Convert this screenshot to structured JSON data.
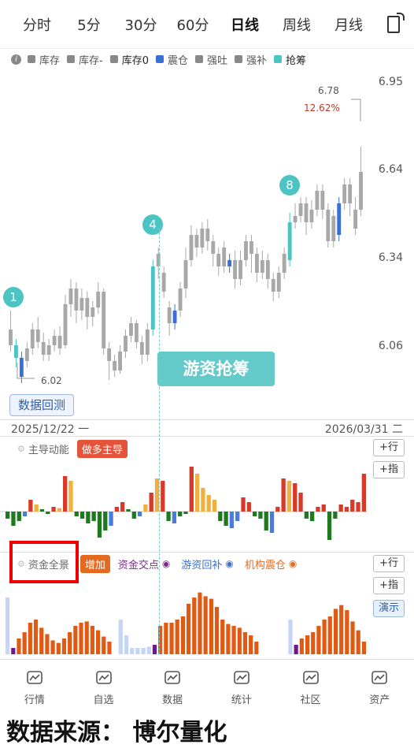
{
  "tabs": [
    "分时",
    "5分",
    "30分",
    "60分",
    "日线",
    "周线",
    "月线"
  ],
  "active_tab": "日线",
  "legend": [
    {
      "label": "库存",
      "color": "#888888"
    },
    {
      "label": "库存-",
      "color": "#888888"
    },
    {
      "label": "库存0",
      "color": "#888888"
    },
    {
      "label": "震仓",
      "color": "#3a6fd8"
    },
    {
      "label": "强吐",
      "color": "#888888"
    },
    {
      "label": "强补",
      "color": "#888888"
    },
    {
      "label": "抢筹",
      "color": "#4cc4c4"
    }
  ],
  "y_axis": [
    "6.95",
    "6.64",
    "6.34",
    "6.06"
  ],
  "high_annotation": {
    "price": "6.78",
    "pct": "12.62%"
  },
  "low_annotation": "6.02",
  "markers": [
    "1",
    "4",
    "8"
  ],
  "banner": "游资抢筹",
  "backtest_label": "数据回测",
  "date_start": "2025/12/22 一",
  "date_end": "2026/03/31 二",
  "panel1": {
    "title": "主导动能",
    "tag": "做多主导",
    "btn_row": "+行",
    "btn_idx": "+指"
  },
  "panel2": {
    "title": "资金全景",
    "tag": "增加",
    "legends": [
      {
        "label": "资金交点",
        "color": "#7b2a8c"
      },
      {
        "label": "游资回补",
        "color": "#3a6fd8"
      },
      {
        "label": "机构震仓",
        "color": "#e36a1e"
      }
    ],
    "btn_row": "+行",
    "btn_idx": "+指",
    "btn_demo": "演示"
  },
  "nav": [
    "行情",
    "自选",
    "数据",
    "统计",
    "社区",
    "资产"
  ],
  "source_text": "数据来源： 博尔量化",
  "chart_data": {
    "type": "candlestick",
    "ylim": [
      5.95,
      7.0
    ],
    "candles": [
      [
        6.2,
        6.15,
        6.26,
        6.13,
        "g"
      ],
      [
        6.15,
        6.11,
        6.17,
        6.08,
        "c"
      ],
      [
        6.11,
        6.05,
        6.13,
        6.03,
        "b"
      ],
      [
        6.1,
        6.14,
        6.16,
        6.08,
        "g"
      ],
      [
        6.14,
        6.2,
        6.22,
        6.12,
        "g"
      ],
      [
        6.2,
        6.16,
        6.24,
        6.14,
        "g"
      ],
      [
        6.16,
        6.12,
        6.19,
        6.1,
        "g"
      ],
      [
        6.12,
        6.15,
        6.17,
        6.1,
        "g"
      ],
      [
        6.15,
        6.18,
        6.2,
        6.13,
        "g"
      ],
      [
        6.18,
        6.14,
        6.21,
        6.12,
        "g"
      ],
      [
        6.15,
        6.28,
        6.31,
        6.14,
        "g"
      ],
      [
        6.28,
        6.33,
        6.36,
        6.24,
        "g"
      ],
      [
        6.33,
        6.26,
        6.35,
        6.22,
        "g"
      ],
      [
        6.26,
        6.3,
        6.33,
        6.23,
        "g"
      ],
      [
        6.3,
        6.24,
        6.32,
        6.2,
        "g"
      ],
      [
        6.24,
        6.27,
        6.29,
        6.21,
        "g"
      ],
      [
        6.27,
        6.32,
        6.35,
        6.25,
        "g"
      ],
      [
        6.32,
        6.14,
        6.33,
        6.12,
        "g"
      ],
      [
        6.14,
        6.1,
        6.16,
        6.04,
        "g"
      ],
      [
        6.1,
        6.07,
        6.12,
        6.05,
        "g"
      ],
      [
        6.07,
        6.13,
        6.15,
        6.06,
        "g"
      ],
      [
        6.13,
        6.18,
        6.2,
        6.11,
        "g"
      ],
      [
        6.18,
        6.22,
        6.24,
        6.16,
        "g"
      ],
      [
        6.22,
        6.16,
        6.23,
        6.14,
        "g"
      ],
      [
        6.16,
        6.12,
        6.18,
        6.09,
        "g"
      ],
      [
        6.12,
        6.2,
        6.22,
        6.1,
        "g"
      ],
      [
        6.2,
        6.4,
        6.42,
        6.18,
        "c"
      ],
      [
        6.4,
        6.44,
        6.46,
        6.36,
        "g"
      ],
      [
        6.32,
        6.38,
        6.4,
        6.3,
        "g"
      ],
      [
        6.22,
        6.27,
        6.29,
        6.18,
        "g"
      ],
      [
        6.22,
        6.26,
        6.28,
        6.2,
        "b"
      ],
      [
        6.26,
        6.33,
        6.35,
        6.24,
        "g"
      ],
      [
        6.33,
        6.42,
        6.46,
        6.3,
        "g"
      ],
      [
        6.42,
        6.5,
        6.53,
        6.4,
        "g"
      ],
      [
        6.5,
        6.46,
        6.52,
        6.43,
        "g"
      ],
      [
        6.46,
        6.52,
        6.54,
        6.44,
        "g"
      ],
      [
        6.52,
        6.48,
        6.55,
        6.45,
        "g"
      ],
      [
        6.48,
        6.44,
        6.5,
        6.4,
        "g"
      ],
      [
        6.44,
        6.4,
        6.46,
        6.37,
        "g"
      ],
      [
        6.4,
        6.46,
        6.48,
        6.38,
        "g"
      ],
      [
        6.4,
        6.42,
        6.44,
        6.38,
        "b"
      ],
      [
        6.42,
        6.36,
        6.45,
        6.33,
        "g"
      ],
      [
        6.36,
        6.42,
        6.45,
        6.34,
        "g"
      ],
      [
        6.42,
        6.48,
        6.5,
        6.4,
        "g"
      ],
      [
        6.48,
        6.44,
        6.5,
        6.38,
        "g"
      ],
      [
        6.44,
        6.38,
        6.46,
        6.35,
        "g"
      ],
      [
        6.38,
        6.42,
        6.45,
        6.36,
        "g"
      ],
      [
        6.42,
        6.36,
        6.44,
        6.33,
        "g"
      ],
      [
        6.36,
        6.32,
        6.38,
        6.29,
        "g"
      ],
      [
        6.32,
        6.38,
        6.4,
        6.3,
        "g"
      ],
      [
        6.38,
        6.44,
        6.46,
        6.36,
        "g"
      ],
      [
        6.42,
        6.54,
        6.57,
        6.4,
        "c"
      ],
      [
        6.54,
        6.56,
        6.6,
        6.52,
        "g"
      ],
      [
        6.56,
        6.6,
        6.62,
        6.54,
        "g"
      ],
      [
        6.6,
        6.54,
        6.62,
        6.5,
        "g"
      ],
      [
        6.54,
        6.58,
        6.61,
        6.52,
        "g"
      ],
      [
        6.58,
        6.64,
        6.66,
        6.56,
        "g"
      ],
      [
        6.64,
        6.58,
        6.66,
        6.55,
        "g"
      ],
      [
        6.58,
        6.48,
        6.6,
        6.46,
        "g"
      ],
      [
        6.48,
        6.56,
        6.58,
        6.46,
        "g"
      ],
      [
        6.5,
        6.6,
        6.62,
        6.48,
        "b"
      ],
      [
        6.6,
        6.66,
        6.68,
        6.58,
        "g"
      ],
      [
        6.66,
        6.6,
        6.68,
        6.56,
        "g"
      ],
      [
        6.52,
        6.58,
        6.62,
        6.5,
        "g"
      ],
      [
        6.58,
        6.7,
        6.78,
        6.56,
        "g"
      ]
    ]
  },
  "momentum_bars": [
    [
      -0.3,
      "g"
    ],
    [
      -0.6,
      "g"
    ],
    [
      -0.4,
      "g"
    ],
    [
      -0.2,
      "b"
    ],
    [
      0.5,
      "r"
    ],
    [
      0.3,
      "o"
    ],
    [
      0.1,
      "g"
    ],
    [
      -0.1,
      "g"
    ],
    [
      0.2,
      "r"
    ],
    [
      0.15,
      "o"
    ],
    [
      1.5,
      "r"
    ],
    [
      1.3,
      "o"
    ],
    [
      -0.2,
      "g"
    ],
    [
      -0.3,
      "g"
    ],
    [
      -0.5,
      "g"
    ],
    [
      -0.4,
      "g"
    ],
    [
      -1.1,
      "g"
    ],
    [
      -0.8,
      "g"
    ],
    [
      -0.6,
      "b"
    ],
    [
      0.2,
      "r"
    ],
    [
      0.4,
      "r"
    ],
    [
      0.1,
      "g"
    ],
    [
      -0.3,
      "g"
    ],
    [
      -0.2,
      "b"
    ],
    [
      0.3,
      "o"
    ],
    [
      0.8,
      "r"
    ],
    [
      1.4,
      "o"
    ],
    [
      1.3,
      "r"
    ],
    [
      -0.4,
      "g"
    ],
    [
      -0.5,
      "b"
    ],
    [
      -0.2,
      "g"
    ],
    [
      -0.1,
      "g"
    ],
    [
      1.9,
      "r"
    ],
    [
      1.6,
      "o"
    ],
    [
      1.0,
      "o"
    ],
    [
      0.7,
      "o"
    ],
    [
      0.5,
      "o"
    ],
    [
      -0.4,
      "g"
    ],
    [
      -0.6,
      "g"
    ],
    [
      -0.7,
      "b"
    ],
    [
      -0.4,
      "b"
    ],
    [
      0.6,
      "r"
    ],
    [
      0.4,
      "r"
    ],
    [
      -0.2,
      "g"
    ],
    [
      -0.3,
      "g"
    ],
    [
      -0.8,
      "g"
    ],
    [
      -0.9,
      "b"
    ],
    [
      0.2,
      "r"
    ],
    [
      1.4,
      "r"
    ],
    [
      1.3,
      "o"
    ],
    [
      1.2,
      "r"
    ],
    [
      0.8,
      "r"
    ],
    [
      -0.3,
      "g"
    ],
    [
      -0.4,
      "g"
    ],
    [
      0.2,
      "r"
    ],
    [
      0.3,
      "r"
    ],
    [
      -1.2,
      "g"
    ],
    [
      -0.3,
      "g"
    ],
    [
      0.3,
      "r"
    ],
    [
      0.2,
      "r"
    ],
    [
      0.5,
      "r"
    ],
    [
      0.4,
      "r"
    ],
    [
      1.6,
      "r"
    ]
  ],
  "capital_bars": [
    [
      0.9,
      "l"
    ],
    [
      0.1,
      "p"
    ],
    [
      0.25,
      "o"
    ],
    [
      0.35,
      "o"
    ],
    [
      0.5,
      "o"
    ],
    [
      0.55,
      "o"
    ],
    [
      0.42,
      "o"
    ],
    [
      0.32,
      "o"
    ],
    [
      0.22,
      "o"
    ],
    [
      0.18,
      "o"
    ],
    [
      0.25,
      "o"
    ],
    [
      0.35,
      "o"
    ],
    [
      0.45,
      "o"
    ],
    [
      0.5,
      "o"
    ],
    [
      0.52,
      "o"
    ],
    [
      0.45,
      "o"
    ],
    [
      0.38,
      "o"
    ],
    [
      0.28,
      "o"
    ],
    [
      0.2,
      "o"
    ],
    [
      0.0,
      ""
    ],
    [
      0.55,
      "l"
    ],
    [
      0.3,
      "l"
    ],
    [
      0.1,
      "l"
    ],
    [
      0.1,
      "l"
    ],
    [
      0.1,
      "l"
    ],
    [
      0.12,
      "l"
    ],
    [
      0.15,
      "p"
    ],
    [
      0.45,
      "o"
    ],
    [
      0.5,
      "o"
    ],
    [
      0.5,
      "o"
    ],
    [
      0.55,
      "o"
    ],
    [
      0.6,
      "o"
    ],
    [
      0.8,
      "o"
    ],
    [
      0.9,
      "o"
    ],
    [
      0.98,
      "o"
    ],
    [
      0.92,
      "o"
    ],
    [
      0.88,
      "o"
    ],
    [
      0.75,
      "o"
    ],
    [
      0.55,
      "o"
    ],
    [
      0.48,
      "o"
    ],
    [
      0.45,
      "o"
    ],
    [
      0.42,
      "o"
    ],
    [
      0.35,
      "o"
    ],
    [
      0.3,
      "o"
    ],
    [
      0.2,
      "o"
    ],
    [
      0.0,
      ""
    ],
    [
      0.0,
      ""
    ],
    [
      0.0,
      ""
    ],
    [
      0.0,
      ""
    ],
    [
      0.0,
      ""
    ],
    [
      0.55,
      "l"
    ],
    [
      0.15,
      "p"
    ],
    [
      0.25,
      "o"
    ],
    [
      0.3,
      "o"
    ],
    [
      0.35,
      "o"
    ],
    [
      0.45,
      "o"
    ],
    [
      0.55,
      "o"
    ],
    [
      0.6,
      "o"
    ],
    [
      0.72,
      "o"
    ],
    [
      0.78,
      "o"
    ],
    [
      0.7,
      "o"
    ],
    [
      0.52,
      "o"
    ],
    [
      0.38,
      "o"
    ],
    [
      0.2,
      "o"
    ]
  ]
}
